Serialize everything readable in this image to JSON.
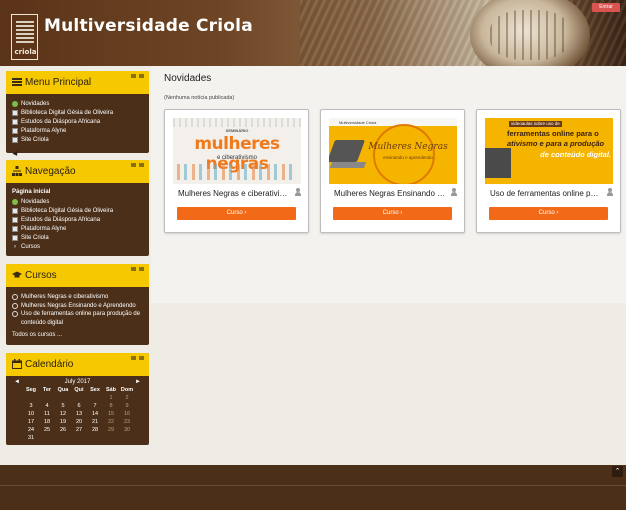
{
  "header": {
    "site_title": "Multiversidade Criola",
    "logo_text": "criola",
    "login_label": "Entrar"
  },
  "main_menu": {
    "title": "Menu Principal",
    "items": [
      {
        "label": "Novidades",
        "icon": "globe-icon"
      },
      {
        "label": "Biblioteca Digital Gésia de Oliveira",
        "icon": "page-icon"
      },
      {
        "label": "Estudos da Diáspora Africana",
        "icon": "page-icon"
      },
      {
        "label": "Plataforma Alyne",
        "icon": "page-icon"
      },
      {
        "label": "Site Criola",
        "icon": "page-icon"
      }
    ]
  },
  "navigation": {
    "title": "Navegação",
    "root": "Página inicial",
    "items": [
      {
        "label": "Novidades",
        "icon": "globe-icon"
      },
      {
        "label": "Biblioteca Digital Gésia de Oliveira",
        "icon": "page-icon"
      },
      {
        "label": "Estudos da Diáspora Africana",
        "icon": "page-icon"
      },
      {
        "label": "Plataforma Alyne",
        "icon": "page-icon"
      },
      {
        "label": "Site Criola",
        "icon": "page-icon"
      },
      {
        "label": "Cursos",
        "icon": "chevron-right-icon"
      }
    ]
  },
  "courses_block": {
    "title": "Cursos",
    "items": [
      {
        "label": "Mulheres Negras e ciberativismo"
      },
      {
        "label": "Mulheres Negras Ensinando e Aprendendo"
      },
      {
        "label": "Uso de ferramentas online para produção de conteúdo digital"
      }
    ],
    "all_label": "Todos os cursos ..."
  },
  "calendar": {
    "title": "Calendário",
    "month": "July 2017",
    "prev": "◄",
    "next": "►",
    "weekdays": [
      "Seg",
      "Ter",
      "Qua",
      "Qui",
      "Sex",
      "Sáb",
      "Dom"
    ],
    "weeks": [
      [
        "",
        "",
        "",
        "",
        "",
        "1",
        "2"
      ],
      [
        "3",
        "4",
        "5",
        "6",
        "7",
        "8",
        "9"
      ],
      [
        "10",
        "11",
        "12",
        "13",
        "14",
        "15",
        "16"
      ],
      [
        "17",
        "18",
        "19",
        "20",
        "21",
        "22",
        "23"
      ],
      [
        "24",
        "25",
        "26",
        "27",
        "28",
        "29",
        "30"
      ],
      [
        "31",
        "",
        "",
        "",
        "",
        "",
        ""
      ]
    ]
  },
  "main": {
    "page_title": "Novidades",
    "no_news": "(Nenhuma notícia publicada)",
    "cards": [
      {
        "name": "Mulheres Negras e ciberativismo",
        "button": "Curso ›",
        "thumb_small": "SEMINÁRIO",
        "thumb_big": "mulheres negras",
        "thumb_sub": "e ciberativismo"
      },
      {
        "name": "Mulheres Negras Ensinando e Aprendendo",
        "button": "Curso ›",
        "thumb_small": "Multiversidade Criola",
        "thumb_big": "Mulheres Negras",
        "thumb_sub": "ensinando e aprendendo"
      },
      {
        "name": "Uso de ferramentas online para produção de conteúdo digital",
        "button": "Curso ›",
        "thumb_small": "videoaulas sobre uso de",
        "thumb_l2": "ferramentas online para o",
        "thumb_l3": "ativismo e para a produção",
        "thumb_l4": "de conteúdo digital."
      }
    ]
  },
  "footer": {
    "to_top": "⌃"
  },
  "colors": {
    "brown": "#4b2f19",
    "yellow": "#f6c800",
    "orange": "#f26a17",
    "login_red": "#d9534f"
  }
}
